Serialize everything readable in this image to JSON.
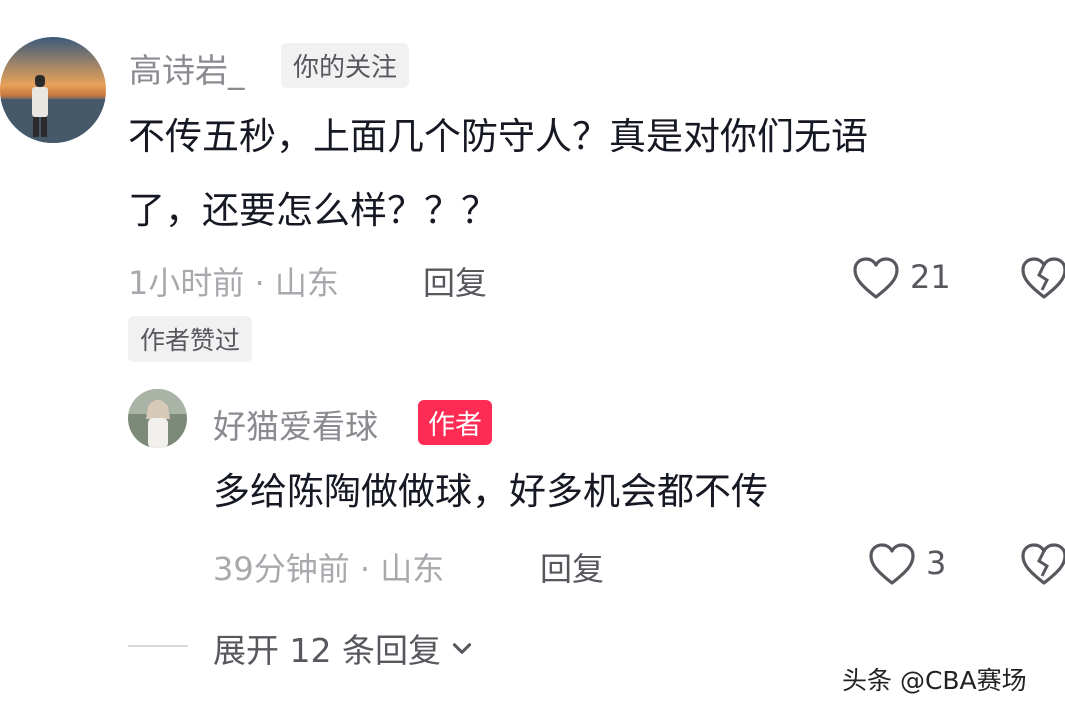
{
  "comment1": {
    "username": "高诗岩_",
    "follow_tag": "你的关注",
    "text_line1": "不传五秒，上面几个防守人？真是对你们无语",
    "text_line2": "了，还要怎么样？？？",
    "meta": "1小时前 · 山东",
    "reply_label": "回复",
    "like_count": "21",
    "author_liked": "作者赞过"
  },
  "comment2": {
    "username": "好猫爱看球",
    "author_tag": "作者",
    "text": "多给陈陶做做球，好多机会都不传",
    "meta": "39分钟前 · 山东",
    "reply_label": "回复",
    "like_count": "3"
  },
  "expand": {
    "label": "展开 12 条回复"
  },
  "watermark": "头条 @CBA赛场",
  "colors": {
    "accent": "#fe2c55",
    "meta_gray": "#a8a9ad",
    "tag_bg": "#f1f1f2"
  }
}
